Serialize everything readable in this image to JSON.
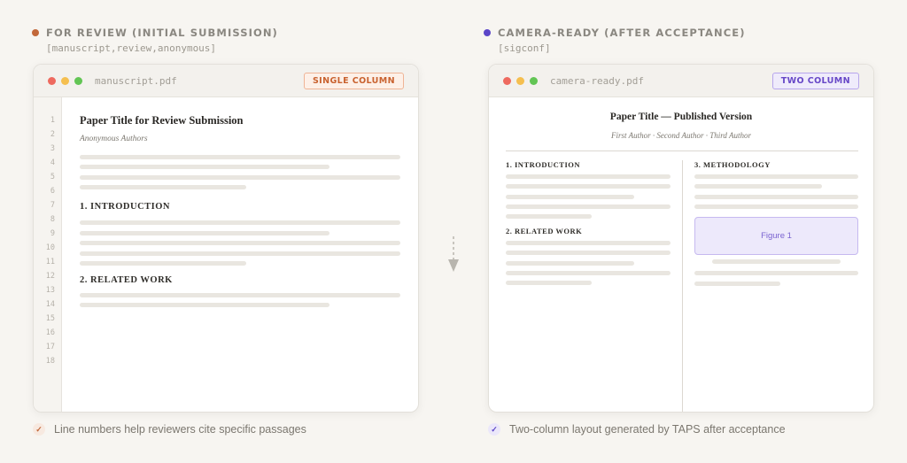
{
  "left": {
    "heading": "FOR REVIEW (INITIAL SUBMISSION)",
    "options": "[manuscript,review,anonymous]",
    "accent": "#c2683a",
    "filename": "manuscript.pdf",
    "badge": "SINGLE COLUMN",
    "line_numbers": [
      "1",
      "2",
      "3",
      "4",
      "5",
      "6",
      "7",
      "8",
      "9",
      "10",
      "11",
      "12",
      "13",
      "14",
      "15",
      "16",
      "17",
      "18"
    ],
    "paper_title": "Paper Title for Review Submission",
    "authors": "Anonymous Authors",
    "sections": [
      "1. INTRODUCTION",
      "2. RELATED WORK"
    ],
    "note_icon": "✓",
    "note": "Line numbers help reviewers cite specific passages"
  },
  "right": {
    "heading": "CAMERA-READY (AFTER ACCEPTANCE)",
    "options": "[sigconf]",
    "accent": "#5b45c8",
    "filename": "camera-ready.pdf",
    "badge": "TWO COLUMN",
    "paper_title": "Paper Title — Published Version",
    "authors": "First Author · Second Author · Third Author",
    "sections": [
      "1. INTRODUCTION",
      "2. RELATED WORK",
      "3. METHODOLOGY"
    ],
    "figure_label": "Figure 1",
    "note_icon": "✓",
    "note": "Two-column layout generated by TAPS after acceptance"
  }
}
